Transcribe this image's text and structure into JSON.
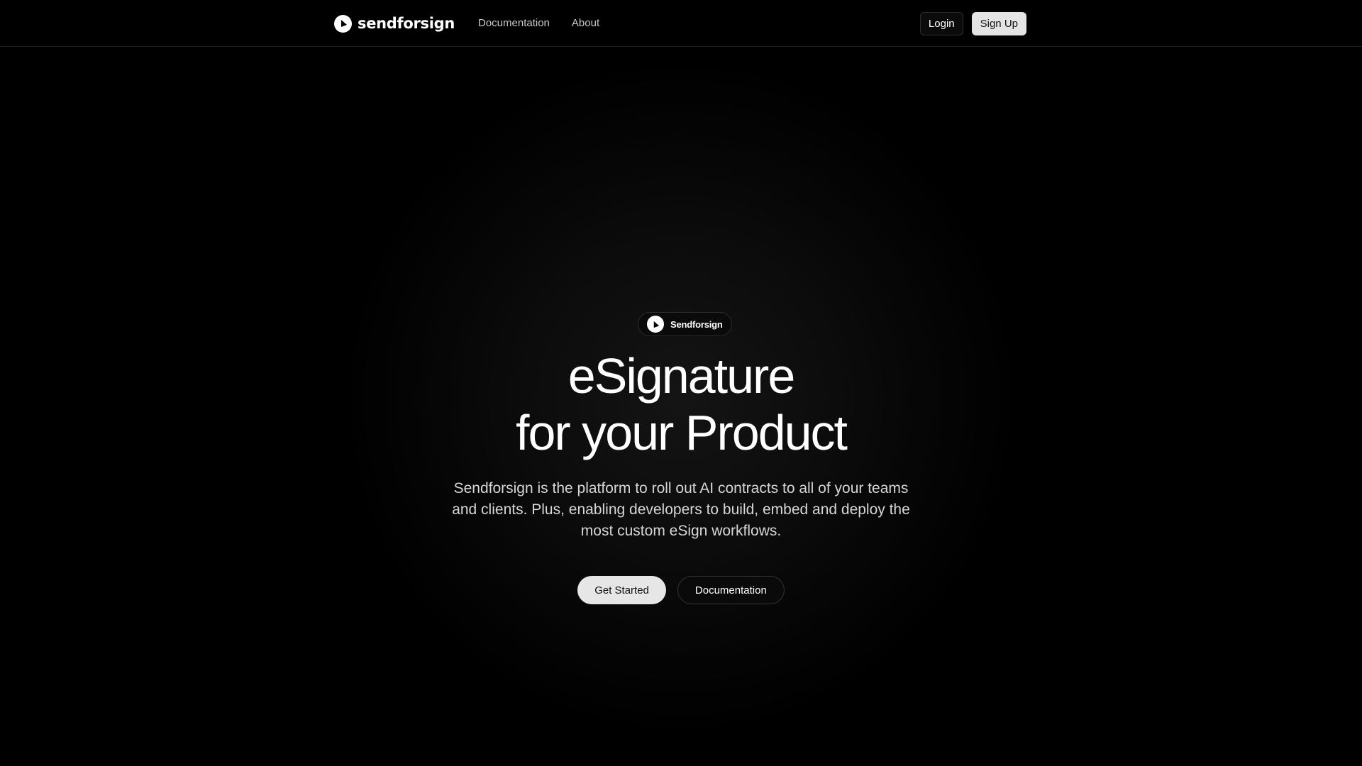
{
  "header": {
    "brand_name": "sendforsign",
    "logo_icon": "sendforsign-logo-icon",
    "nav": [
      {
        "label": "Documentation"
      },
      {
        "label": "About"
      }
    ],
    "login_label": "Login",
    "signup_label": "Sign Up"
  },
  "hero": {
    "badge_label": "Sendforsign",
    "headline_line1": "eSignature",
    "headline_line2": "for your Product",
    "description": "Sendforsign is the platform to roll out AI contracts to all of your teams and clients. Plus, enabling developers to build, embed and deploy the most custom eSign workflows.",
    "primary_cta": "Get Started",
    "secondary_cta": "Documentation"
  },
  "colors": {
    "background": "#000000",
    "text": "#ffffff",
    "button_light": "#e6e6e6"
  }
}
